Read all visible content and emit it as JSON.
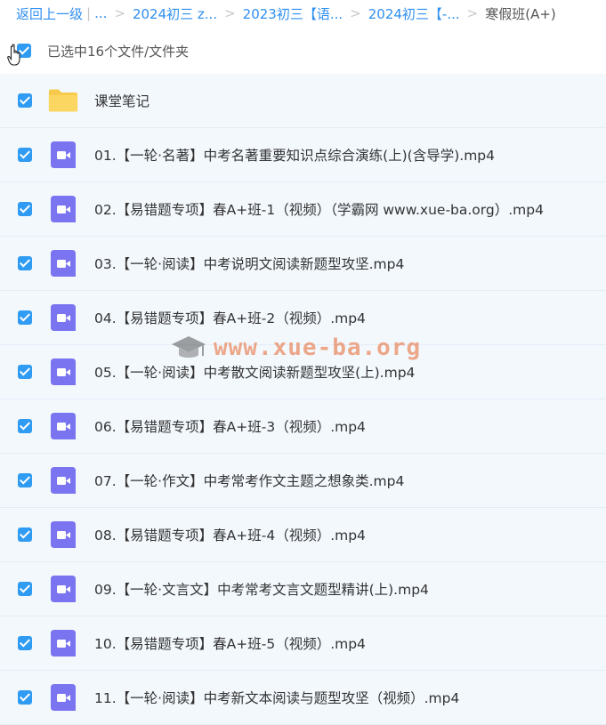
{
  "breadcrumb": {
    "back": "返回上一级",
    "ellipsis": "...",
    "items": [
      "2024初三 z...",
      "2023初三【语...",
      "2024初三【-..."
    ],
    "current": "寒假班(A+)"
  },
  "selection": {
    "text": "已选中16个文件/文件夹"
  },
  "files": [
    {
      "type": "folder",
      "name": "课堂笔记",
      "icon": "folder-icon"
    },
    {
      "type": "video",
      "name": "01.【一轮·名著】中考名著重要知识点综合演练(上)(含导学).mp4",
      "icon": "video-icon"
    },
    {
      "type": "video",
      "name": "02.【易错题专项】春A+班-1（视频）（学霸网 www.xue-ba.org）.mp4",
      "icon": "video-icon"
    },
    {
      "type": "video",
      "name": "03.【一轮·阅读】中考说明文阅读新题型攻坚.mp4",
      "icon": "video-icon"
    },
    {
      "type": "video",
      "name": "04.【易错题专项】春A+班-2（视频）.mp4",
      "icon": "video-icon"
    },
    {
      "type": "video",
      "name": "05.【一轮·阅读】中考散文阅读新题型攻坚(上).mp4",
      "icon": "video-icon"
    },
    {
      "type": "video",
      "name": "06.【易错题专项】春A+班-3（视频）.mp4",
      "icon": "video-icon"
    },
    {
      "type": "video",
      "name": "07.【一轮·作文】中考常考作文主题之想象类.mp4",
      "icon": "video-icon"
    },
    {
      "type": "video",
      "name": "08.【易错题专项】春A+班-4（视频）.mp4",
      "icon": "video-icon"
    },
    {
      "type": "video",
      "name": "09.【一轮·文言文】中考常考文言文题型精讲(上).mp4",
      "icon": "video-icon"
    },
    {
      "type": "video",
      "name": "10.【易错题专项】春A+班-5（视频）.mp4",
      "icon": "video-icon"
    },
    {
      "type": "video",
      "name": "11.【一轮·阅读】中考新文本阅读与题型攻坚（视频）.mp4",
      "icon": "video-icon"
    }
  ],
  "watermark": {
    "text": "www.xue-ba.org"
  },
  "colors": {
    "accent": "#2f9bf2",
    "link": "#2f8ff0",
    "video_icon": "#7b74f0",
    "folder": "#f7c94a",
    "row_bg": "#f3f8fd"
  }
}
